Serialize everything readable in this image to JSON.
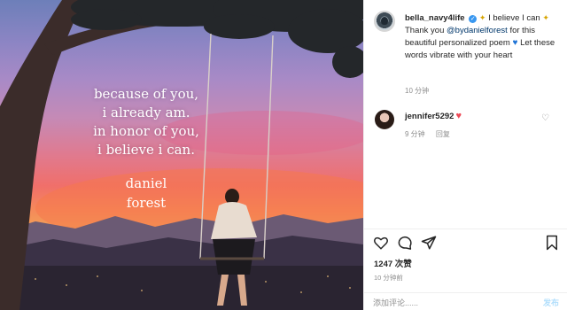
{
  "photo": {
    "poem_lines": [
      "because of you,",
      "i already am.",
      "in honor of you,",
      "i believe i can."
    ],
    "signature_lines": [
      "daniel",
      "forest"
    ]
  },
  "post": {
    "username": "bella_navy4life",
    "caption_head": "I believe I can",
    "caption_thanks": "Thank you",
    "mention": "@bydanielforest",
    "caption_mid": "for this beautiful personalized poem",
    "caption_tail": "Let these words vibrate with your heart",
    "time": "10 分钟"
  },
  "comment": {
    "username": "jennifer5292",
    "time": "9 分钟",
    "reply_label": "回复"
  },
  "stats": {
    "likes": "1247 次赞",
    "time": "10 分钟前"
  },
  "add_comment": {
    "placeholder": "添加评论......",
    "post_label": "发布"
  },
  "colors": {
    "verified": "#3897f0",
    "mention": "#00376b",
    "heart_red": "#ed4956",
    "heart_blue": "#1d73d6",
    "muted": "#8e8e8e"
  },
  "icons": [
    "verified-icon",
    "bee-icon",
    "blue-heart-icon",
    "red-heart-icon",
    "like-icon",
    "comment-icon",
    "share-icon",
    "save-icon",
    "small-heart-icon"
  ]
}
